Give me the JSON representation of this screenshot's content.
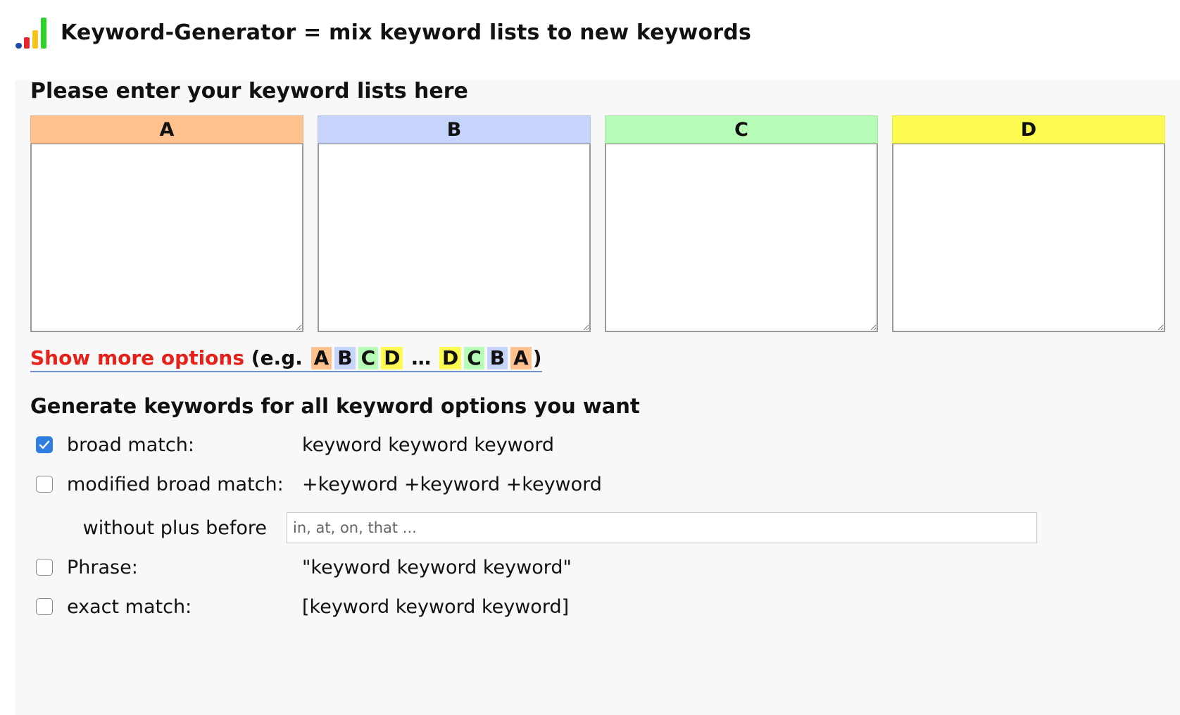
{
  "app": {
    "title": "Keyword-Generator = mix keyword lists to new keywords",
    "logo_colors": [
      "#1d4fa8",
      "#e5262c",
      "#f6c21c",
      "#2fd12b"
    ]
  },
  "lists": {
    "title": "Please enter your keyword lists here",
    "columns": [
      {
        "label": "A",
        "color": "#ffc18e",
        "value": ""
      },
      {
        "label": "B",
        "color": "#c6d3fa",
        "value": ""
      },
      {
        "label": "C",
        "color": "#b6fbb6",
        "value": ""
      },
      {
        "label": "D",
        "color": "#fdfa52",
        "value": ""
      }
    ]
  },
  "more_options": {
    "link_label": "Show more options",
    "prefix": "(e.g.",
    "ellipsis": "…",
    "suffix": ")",
    "chips_left": [
      "A",
      "B",
      "C",
      "D"
    ],
    "chips_right": [
      "D",
      "C",
      "B",
      "A"
    ]
  },
  "generate": {
    "title": "Generate keywords for all keyword options you want",
    "options": [
      {
        "label": "broad match:",
        "example": "keyword keyword keyword",
        "checked": true
      },
      {
        "label": "modified broad match:",
        "example": "+keyword +keyword +keyword",
        "checked": false
      },
      {
        "label": "Phrase:",
        "example": "\"keyword keyword keyword\"",
        "checked": false
      },
      {
        "label": "exact match:",
        "example": "[keyword keyword keyword]",
        "checked": false
      }
    ],
    "without_plus": {
      "label": "without plus before",
      "placeholder": "in, at, on, that ...",
      "value": ""
    }
  }
}
